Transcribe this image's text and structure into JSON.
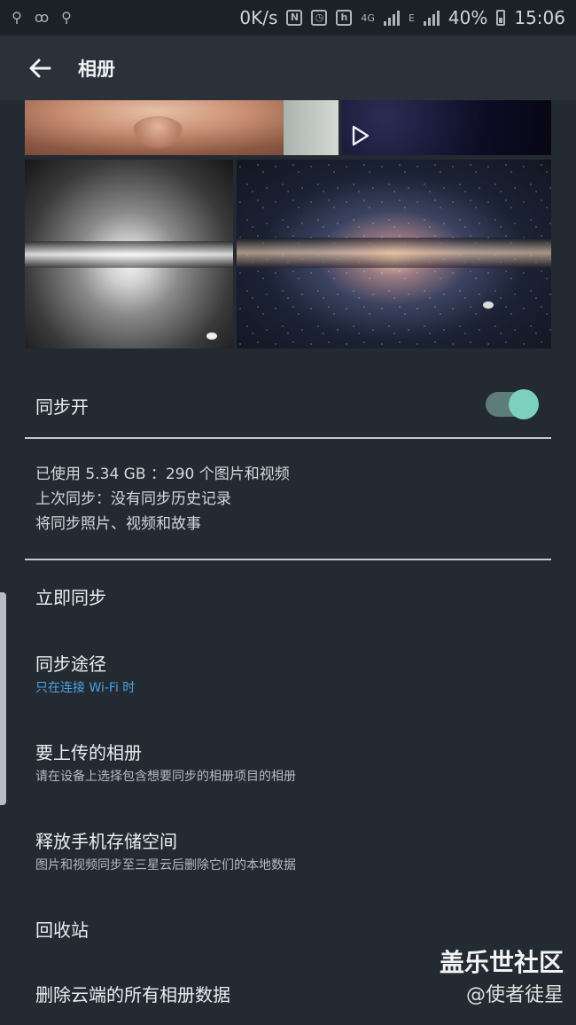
{
  "status_bar": {
    "speed": "0K/s",
    "network": "4G",
    "network_e": "E",
    "battery": "40%",
    "time": "15:06"
  },
  "appbar": {
    "title": "相册"
  },
  "sync": {
    "label": "同步开",
    "enabled": true
  },
  "storage": {
    "used": "已使用 5.34 GB ：290 个图片和视频",
    "last_sync": "上次同步：没有同步历史记录",
    "will_sync": "将同步照片、视频和故事"
  },
  "menu": [
    {
      "title": "立即同步"
    },
    {
      "title": "同步途径",
      "subtitle": "只在连接 Wi-Fi 时"
    },
    {
      "title": "要上传的相册",
      "subtitle": "请在设备上选择包含想要同步的相册项目的相册"
    },
    {
      "title": "释放手机存储空间",
      "subtitle": "图片和视频同步至三星云后删除它们的本地数据"
    },
    {
      "title": "回收站"
    },
    {
      "title": "删除云端的所有相册数据"
    }
  ],
  "watermark": {
    "line1": "盖乐世社区",
    "line2": "@使者徒星"
  },
  "colors": {
    "accent": "#7dd0bd",
    "link": "#4aa3e6",
    "background": "#232a31"
  }
}
